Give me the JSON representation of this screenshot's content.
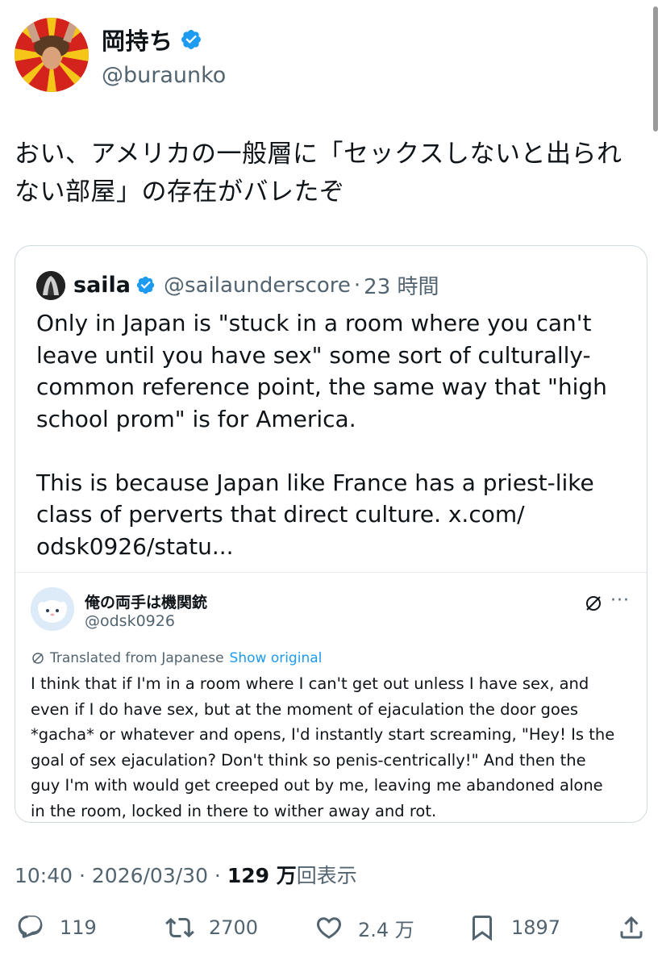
{
  "author": {
    "display_name": "岡持ち",
    "handle": "@buraunko"
  },
  "tweet": {
    "lines": [
      "おい、アメリカの一般層に「セックスしないと出られ",
      "ない部屋」の存在がバレたぞ"
    ]
  },
  "quote": {
    "name": "saila",
    "handle": "@sailaunderscore",
    "separator": "·",
    "time": "23 時間",
    "paragraphs": [
      [
        "Only in Japan is \"stuck in a room where you can't",
        "leave until you have sex\" some sort of culturally-",
        "common reference point, the same way that \"high",
        "school prom\" is for America."
      ],
      [
        "This is because Japan like France has a priest-like",
        "class of perverts that direct culture. x.com/",
        "odsk0926/statu..."
      ]
    ],
    "embed": {
      "name": "俺の両手は機関銃",
      "handle": "@odsk0926",
      "more": "···",
      "translated_label": "Translated from Japanese",
      "show_original": "Show original",
      "lines": [
        "I think that if I'm in a room where I can't get out unless I have sex, and",
        "even if I do have sex, but at the moment of ejaculation the door goes",
        "*gacha* or whatever and opens, I'd instantly start screaming, \"Hey! Is the",
        "goal of sex ejaculation? Don't think so penis-centrically!\" And then the",
        "guy I'm with would get creeped out by me, leaving me abandoned alone",
        "in the room, locked in there to wither away and rot."
      ]
    }
  },
  "meta": {
    "time": "10:40",
    "dot1": " · ",
    "date": "2026/03/30",
    "dot2": " · ",
    "views_count": "129 万",
    "views_label": "回表示"
  },
  "actions": {
    "replies": "119",
    "retweets": "2700",
    "likes": "2.4 万",
    "bookmarks": "1897"
  },
  "icons": {
    "verified": "verified-badge-icon",
    "reply": "reply-icon",
    "retweet": "retweet-icon",
    "like": "heart-icon",
    "bookmark": "bookmark-icon",
    "share": "share-icon"
  },
  "colors": {
    "accent": "#1d9bf0",
    "text": "#0f1419",
    "muted": "#536471",
    "border": "#cfd9de"
  }
}
